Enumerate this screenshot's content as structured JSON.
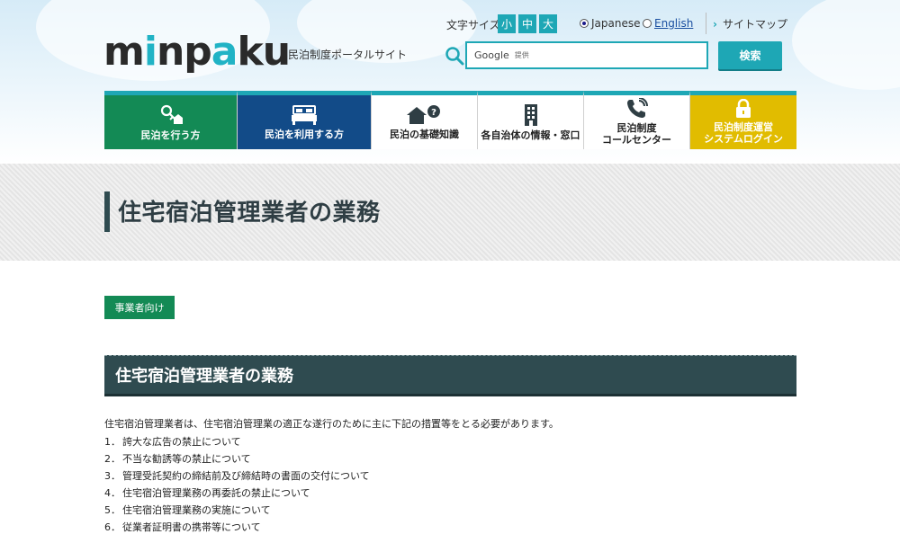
{
  "header": {
    "logo_text": "minpaku",
    "tagline": "民泊制度ポータルサイト",
    "fontsize_label": "文字サイズ",
    "fontsize_small": "小",
    "fontsize_medium": "中",
    "fontsize_large": "大",
    "lang_japanese": "Japanese",
    "lang_english": "English",
    "sitemap": "サイトマップ",
    "search_provider": "Google",
    "search_provider_suffix": "提供",
    "search_button": "検索"
  },
  "nav": [
    {
      "label": "民泊を行う方",
      "icon": "key-house-icon"
    },
    {
      "label": "民泊を利用する方",
      "icon": "bed-icon"
    },
    {
      "label": "民泊の基礎知識",
      "icon": "house-question-icon"
    },
    {
      "label": "各自治体の情報・窓口",
      "icon": "building-icon"
    },
    {
      "label_line1": "民泊制度",
      "label_line2": "コールセンター",
      "icon": "phone-icon"
    },
    {
      "label_line1": "民泊制度運営",
      "label_line2": "システムログイン",
      "icon": "lock-icon"
    }
  ],
  "page_title": "住宅宿泊管理業者の業務",
  "tag": "事業者向け",
  "section": {
    "heading": "住宅宿泊管理業者の業務",
    "intro": "住宅宿泊管理業者は、住宅宿泊管理業の適正な遂行のために主に下記の措置等をとる必要があります。",
    "items": [
      {
        "num": "1．",
        "text": "誇大な広告の禁止について"
      },
      {
        "num": "2．",
        "text": "不当な勧誘等の禁止について"
      },
      {
        "num": "3．",
        "text": "管理受託契約の締結前及び締結時の書面の交付について"
      },
      {
        "num": "4．",
        "text": "住宅宿泊管理業務の再委託の禁止について"
      },
      {
        "num": "5．",
        "text": "住宅宿泊管理業務の実施について"
      },
      {
        "num": "6．",
        "text": "従業者証明書の携帯等について"
      }
    ]
  },
  "colors": {
    "teal": "#1ea7b5",
    "green": "#138a55",
    "blue": "#124b88",
    "yellow": "#e1bc00",
    "dark_slate": "#2f4b50"
  }
}
